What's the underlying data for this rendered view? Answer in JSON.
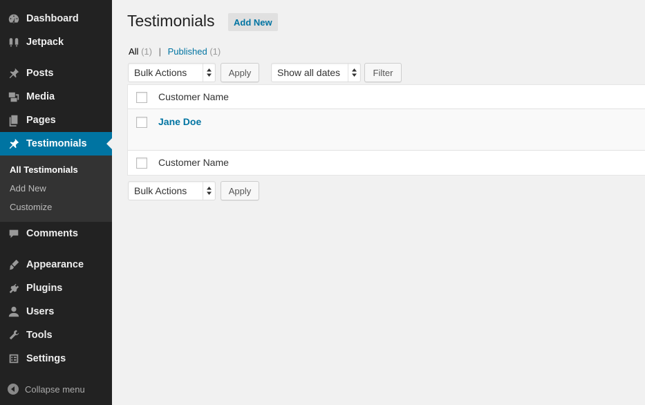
{
  "sidebar": {
    "items": [
      {
        "label": "Dashboard",
        "icon": "dashboard-icon"
      },
      {
        "label": "Jetpack",
        "icon": "jetpack-icon"
      },
      {
        "label": "Posts",
        "icon": "pin-icon"
      },
      {
        "label": "Media",
        "icon": "media-icon"
      },
      {
        "label": "Pages",
        "icon": "pages-icon"
      },
      {
        "label": "Testimonials",
        "icon": "pin-icon"
      },
      {
        "label": "Comments",
        "icon": "comment-icon"
      },
      {
        "label": "Appearance",
        "icon": "brush-icon"
      },
      {
        "label": "Plugins",
        "icon": "plugin-icon"
      },
      {
        "label": "Users",
        "icon": "user-icon"
      },
      {
        "label": "Tools",
        "icon": "wrench-icon"
      },
      {
        "label": "Settings",
        "icon": "settings-icon"
      }
    ],
    "submenu": [
      "All Testimonials",
      "Add New",
      "Customize"
    ],
    "collapse_label": "Collapse menu",
    "active_color": "#0074a2"
  },
  "main": {
    "title": "Testimonials",
    "add_new_label": "Add New",
    "views": {
      "all_label": "All",
      "all_count": "(1)",
      "published_label": "Published",
      "published_count": "(1)",
      "separator": "|"
    },
    "top_nav": {
      "bulk_actions": "Bulk Actions",
      "apply": "Apply",
      "dates": "Show all dates",
      "filter": "Filter"
    },
    "bottom_nav": {
      "bulk_actions": "Bulk Actions",
      "apply": "Apply"
    },
    "table": {
      "column_header": "Customer Name",
      "column_footer": "Customer Name",
      "rows": [
        {
          "name": "Jane Doe"
        }
      ]
    },
    "link_color": "#0074a2"
  }
}
